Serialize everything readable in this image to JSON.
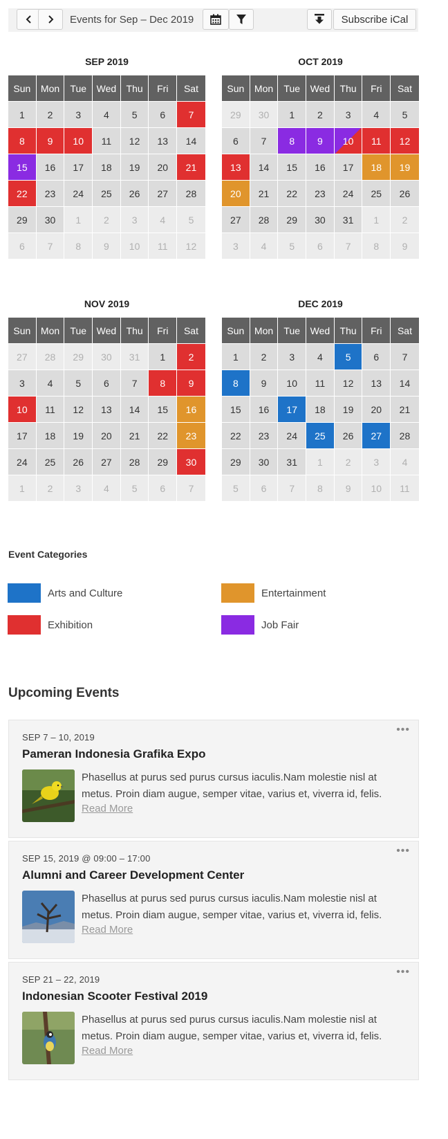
{
  "toolbar": {
    "prev_icon": "chevron-left-icon",
    "next_icon": "chevron-right-icon",
    "title": "Events for Sep – Dec 2019",
    "calendar_icon": "calendar-icon",
    "filter_icon": "filter-icon",
    "download_icon": "download-icon",
    "subscribe_label": "Subscribe iCal"
  },
  "colors": {
    "arts": "#1e73c8",
    "entertainment": "#e0952c",
    "exhibition": "#e03030",
    "jobfair": "#8a2be2"
  },
  "weekdays": [
    "Sun",
    "Mon",
    "Tue",
    "Wed",
    "Thu",
    "Fri",
    "Sat"
  ],
  "calendars": [
    {
      "title": "SEP 2019",
      "rows": [
        [
          {
            "d": "1"
          },
          {
            "d": "2"
          },
          {
            "d": "3"
          },
          {
            "d": "4"
          },
          {
            "d": "5"
          },
          {
            "d": "6"
          },
          {
            "d": "7",
            "c": "exhibition"
          }
        ],
        [
          {
            "d": "8",
            "c": "exhibition"
          },
          {
            "d": "9",
            "c": "exhibition"
          },
          {
            "d": "10",
            "c": "exhibition"
          },
          {
            "d": "11"
          },
          {
            "d": "12"
          },
          {
            "d": "13"
          },
          {
            "d": "14"
          }
        ],
        [
          {
            "d": "15",
            "c": "jobfair"
          },
          {
            "d": "16"
          },
          {
            "d": "17"
          },
          {
            "d": "18"
          },
          {
            "d": "19"
          },
          {
            "d": "20"
          },
          {
            "d": "21",
            "c": "exhibition"
          }
        ],
        [
          {
            "d": "22",
            "c": "exhibition"
          },
          {
            "d": "23"
          },
          {
            "d": "24"
          },
          {
            "d": "25"
          },
          {
            "d": "26"
          },
          {
            "d": "27"
          },
          {
            "d": "28"
          }
        ],
        [
          {
            "d": "29"
          },
          {
            "d": "30"
          },
          {
            "d": "1",
            "o": 1
          },
          {
            "d": "2",
            "o": 1
          },
          {
            "d": "3",
            "o": 1
          },
          {
            "d": "4",
            "o": 1
          },
          {
            "d": "5",
            "o": 1
          }
        ],
        [
          {
            "d": "6",
            "o": 1
          },
          {
            "d": "7",
            "o": 1
          },
          {
            "d": "8",
            "o": 1
          },
          {
            "d": "9",
            "o": 1
          },
          {
            "d": "10",
            "o": 1
          },
          {
            "d": "11",
            "o": 1
          },
          {
            "d": "12",
            "o": 1
          }
        ]
      ]
    },
    {
      "title": "OCT 2019",
      "rows": [
        [
          {
            "d": "29",
            "o": 1
          },
          {
            "d": "30",
            "o": 1
          },
          {
            "d": "1"
          },
          {
            "d": "2"
          },
          {
            "d": "3"
          },
          {
            "d": "4"
          },
          {
            "d": "5"
          }
        ],
        [
          {
            "d": "6"
          },
          {
            "d": "7"
          },
          {
            "d": "8",
            "c": "jobfair"
          },
          {
            "d": "9",
            "c": "jobfair"
          },
          {
            "d": "10",
            "c": "jobfair",
            "c2": "exhibition"
          },
          {
            "d": "11",
            "c": "exhibition"
          },
          {
            "d": "12",
            "c": "exhibition"
          }
        ],
        [
          {
            "d": "13",
            "c": "exhibition"
          },
          {
            "d": "14"
          },
          {
            "d": "15"
          },
          {
            "d": "16"
          },
          {
            "d": "17"
          },
          {
            "d": "18",
            "c": "entertainment"
          },
          {
            "d": "19",
            "c": "entertainment"
          }
        ],
        [
          {
            "d": "20",
            "c": "entertainment"
          },
          {
            "d": "21"
          },
          {
            "d": "22"
          },
          {
            "d": "23"
          },
          {
            "d": "24"
          },
          {
            "d": "25"
          },
          {
            "d": "26"
          }
        ],
        [
          {
            "d": "27"
          },
          {
            "d": "28"
          },
          {
            "d": "29"
          },
          {
            "d": "30"
          },
          {
            "d": "31"
          },
          {
            "d": "1",
            "o": 1
          },
          {
            "d": "2",
            "o": 1
          }
        ],
        [
          {
            "d": "3",
            "o": 1
          },
          {
            "d": "4",
            "o": 1
          },
          {
            "d": "5",
            "o": 1
          },
          {
            "d": "6",
            "o": 1
          },
          {
            "d": "7",
            "o": 1
          },
          {
            "d": "8",
            "o": 1
          },
          {
            "d": "9",
            "o": 1
          }
        ]
      ]
    },
    {
      "title": "NOV 2019",
      "rows": [
        [
          {
            "d": "27",
            "o": 1
          },
          {
            "d": "28",
            "o": 1
          },
          {
            "d": "29",
            "o": 1
          },
          {
            "d": "30",
            "o": 1
          },
          {
            "d": "31",
            "o": 1
          },
          {
            "d": "1"
          },
          {
            "d": "2",
            "c": "exhibition"
          }
        ],
        [
          {
            "d": "3"
          },
          {
            "d": "4"
          },
          {
            "d": "5"
          },
          {
            "d": "6"
          },
          {
            "d": "7"
          },
          {
            "d": "8",
            "c": "exhibition"
          },
          {
            "d": "9",
            "c": "exhibition"
          }
        ],
        [
          {
            "d": "10",
            "c": "exhibition"
          },
          {
            "d": "11"
          },
          {
            "d": "12"
          },
          {
            "d": "13"
          },
          {
            "d": "14"
          },
          {
            "d": "15"
          },
          {
            "d": "16",
            "c": "entertainment"
          }
        ],
        [
          {
            "d": "17"
          },
          {
            "d": "18"
          },
          {
            "d": "19"
          },
          {
            "d": "20"
          },
          {
            "d": "21"
          },
          {
            "d": "22"
          },
          {
            "d": "23",
            "c": "entertainment"
          }
        ],
        [
          {
            "d": "24"
          },
          {
            "d": "25"
          },
          {
            "d": "26"
          },
          {
            "d": "27"
          },
          {
            "d": "28"
          },
          {
            "d": "29"
          },
          {
            "d": "30",
            "c": "exhibition"
          }
        ],
        [
          {
            "d": "1",
            "o": 1
          },
          {
            "d": "2",
            "o": 1
          },
          {
            "d": "3",
            "o": 1
          },
          {
            "d": "4",
            "o": 1
          },
          {
            "d": "5",
            "o": 1
          },
          {
            "d": "6",
            "o": 1
          },
          {
            "d": "7",
            "o": 1
          }
        ]
      ]
    },
    {
      "title": "DEC 2019",
      "rows": [
        [
          {
            "d": "1"
          },
          {
            "d": "2"
          },
          {
            "d": "3"
          },
          {
            "d": "4"
          },
          {
            "d": "5",
            "c": "arts"
          },
          {
            "d": "6"
          },
          {
            "d": "7"
          }
        ],
        [
          {
            "d": "8",
            "c": "arts"
          },
          {
            "d": "9"
          },
          {
            "d": "10"
          },
          {
            "d": "11"
          },
          {
            "d": "12"
          },
          {
            "d": "13"
          },
          {
            "d": "14"
          }
        ],
        [
          {
            "d": "15"
          },
          {
            "d": "16"
          },
          {
            "d": "17",
            "c": "arts"
          },
          {
            "d": "18"
          },
          {
            "d": "19"
          },
          {
            "d": "20"
          },
          {
            "d": "21"
          }
        ],
        [
          {
            "d": "22"
          },
          {
            "d": "23"
          },
          {
            "d": "24"
          },
          {
            "d": "25",
            "c": "arts"
          },
          {
            "d": "26"
          },
          {
            "d": "27",
            "c": "arts"
          },
          {
            "d": "28"
          }
        ],
        [
          {
            "d": "29"
          },
          {
            "d": "30"
          },
          {
            "d": "31"
          },
          {
            "d": "1",
            "o": 1
          },
          {
            "d": "2",
            "o": 1
          },
          {
            "d": "3",
            "o": 1
          },
          {
            "d": "4",
            "o": 1
          }
        ],
        [
          {
            "d": "5",
            "o": 1
          },
          {
            "d": "6",
            "o": 1
          },
          {
            "d": "7",
            "o": 1
          },
          {
            "d": "8",
            "o": 1
          },
          {
            "d": "9",
            "o": 1
          },
          {
            "d": "10",
            "o": 1
          },
          {
            "d": "11",
            "o": 1
          }
        ]
      ]
    }
  ],
  "legend": {
    "title": "Event Categories",
    "items": [
      {
        "label": "Arts and Culture",
        "color": "#1e73c8"
      },
      {
        "label": "Entertainment",
        "color": "#e0952c"
      },
      {
        "label": "Exhibition",
        "color": "#e03030"
      },
      {
        "label": "Job Fair",
        "color": "#8a2be2"
      }
    ]
  },
  "upcoming": {
    "title": "Upcoming Events",
    "more_icon": "more-dots-icon",
    "events": [
      {
        "date": "SEP 7 – 10, 2019",
        "name": "Pameran Indonesia Grafika Expo",
        "thumb_icon": "yellow-bird-image",
        "desc": "Phasellus at purus sed purus cursus iaculis.Nam molestie nisl at metus. Proin diam augue, semper vitae, varius et, viverra id, felis.",
        "more": "Read More"
      },
      {
        "date": "SEP 15, 2019 @ 09:00 – 17:00",
        "name": "Alumni and Career Development Center",
        "thumb_icon": "winter-tree-image",
        "desc": "Phasellus at purus sed purus cursus iaculis.Nam molestie nisl at metus. Proin diam augue, semper vitae, varius et, viverra id, felis.",
        "more": "Read More"
      },
      {
        "date": "SEP 21 – 22, 2019",
        "name": "Indonesian Scooter Festival 2019",
        "thumb_icon": "small-bird-branch-image",
        "desc": "Phasellus at purus sed purus cursus iaculis.Nam molestie nisl at metus. Proin diam augue, semper vitae, varius et, viverra id, felis.",
        "more": "Read More"
      }
    ]
  }
}
